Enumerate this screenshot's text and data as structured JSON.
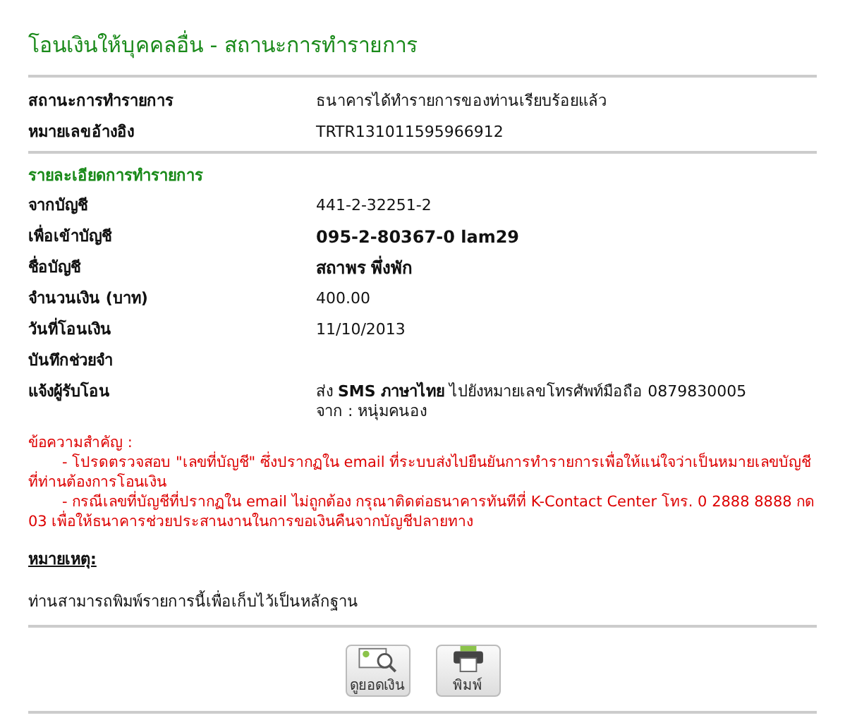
{
  "title": "โอนเงินให้บุคคลอื่น - สถานะการทำรายการ",
  "status_rows": [
    {
      "label": "สถานะการทำรายการ",
      "lines": [
        "ธนาคารได้ทำรายการของท่านเรียบร้อยแล้ว"
      ],
      "bold": false
    },
    {
      "label": "หมายเลขอ้างอิง",
      "lines": [
        "TRTR131011595966912"
      ],
      "bold": false
    }
  ],
  "details": {
    "heading": "รายละเอียดการทำรายการ",
    "rows": [
      {
        "label": "จากบัญชี",
        "lines": [
          "441-2-32251-2"
        ],
        "bold": false
      },
      {
        "label": "เพื่อเข้าบัญชี",
        "lines": [
          "095-2-80367-0 lam29"
        ],
        "bold": true
      },
      {
        "label": "ชื่อบัญชี",
        "lines": [
          "สถาพร พึ่งพัก"
        ],
        "bold": true
      },
      {
        "label": "จำนวนเงิน (บาท)",
        "lines": [
          "400.00"
        ],
        "bold": false
      },
      {
        "label": "วันที่โอนเงิน",
        "lines": [
          "11/10/2013"
        ],
        "bold": false
      },
      {
        "label": "บันทึกช่วยจำ",
        "lines": []
      },
      {
        "label": "แจ้งผู้รับโอน",
        "lines": [
          "ส่ง **SMS ภาษาไทย** ไปยังหมายเลขโทรศัพท์มือถือ 0879830005",
          "จาก : หนุ่มคนอง"
        ],
        "bold": false
      }
    ]
  },
  "notice": {
    "heading": "ข้อความสำคัญ :",
    "items": [
      "- โปรดตรวจสอบ \"เลขที่บัญชี\" ซึ่งปรากฏใน email ที่ระบบส่งไปยืนยันการทำรายการเพื่อให้แน่ใจว่าเป็นหมายเลขบัญชีที่ท่านต้องการโอนเงิน",
      "- กรณีเลขที่บัญชีที่ปรากฏใน email ไม่ถูกต้อง กรุณาติดต่อธนาคารทันทีที่ K-Contact Center โทร. 0 2888 8888 กด 03 เพื่อให้ธนาคารช่วยประสานงานในการขอเงินคืนจากบัญชีปลายทาง"
    ]
  },
  "remark": {
    "heading": "หมายเหตุ:",
    "text": "ท่านสามารถพิมพ์รายการนี้เพื่อเก็บไว้เป็นหลักฐาน"
  },
  "buttons": [
    {
      "kind": "balance",
      "label": "ดูยอดเงิน"
    },
    {
      "kind": "print",
      "label": "พิมพ์"
    }
  ]
}
